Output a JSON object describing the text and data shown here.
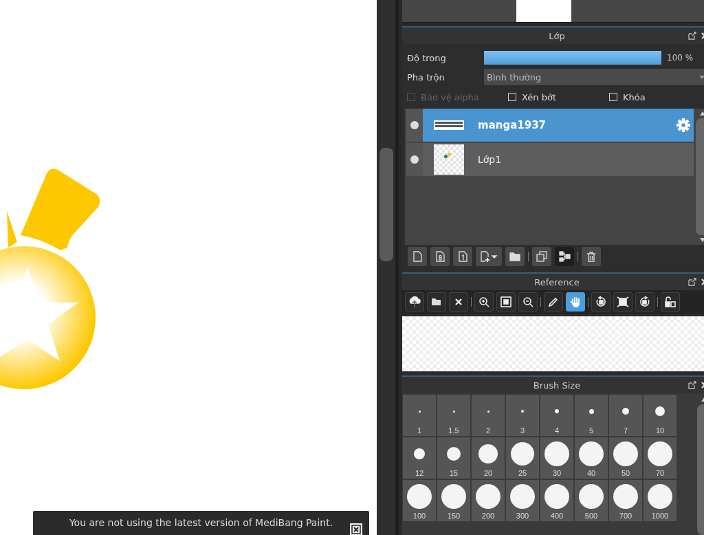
{
  "notification": {
    "message": "You are not using the latest version of MediBang Paint."
  },
  "layer_panel": {
    "title": "Lớp",
    "opacity": {
      "label": "Độ trong",
      "level": 1.0,
      "reading": "100 %"
    },
    "blend": {
      "label": "Pha trộn",
      "value": "Bình thường"
    },
    "options": [
      {
        "label": "Bảo vệ alpha",
        "checked": false,
        "disabled": true
      },
      {
        "label": "Xén bớt",
        "checked": false,
        "disabled": false
      },
      {
        "label": "Khóa",
        "checked": false,
        "disabled": false
      }
    ],
    "layers": [
      {
        "name": "manga1937",
        "selected": true,
        "visible": true,
        "kind": "image"
      },
      {
        "name": "Lớp1",
        "selected": false,
        "visible": true,
        "kind": "transparent"
      }
    ],
    "tools": [
      {
        "kind": "new"
      },
      {
        "kind": "new-8bit"
      },
      {
        "kind": "new-1bit"
      },
      {
        "kind": "add-menu"
      },
      {
        "kind": "folder"
      },
      {
        "kind": "separator"
      },
      {
        "kind": "duplicate"
      },
      {
        "kind": "merge"
      },
      {
        "kind": "separator"
      },
      {
        "kind": "delete"
      }
    ]
  },
  "reference_panel": {
    "title": "Reference",
    "tool_groups": [
      [
        {
          "kind": "upload",
          "selected": false
        },
        {
          "kind": "open",
          "selected": false
        },
        {
          "kind": "clear",
          "selected": false
        }
      ],
      [
        {
          "kind": "zoom-in",
          "selected": false
        },
        {
          "kind": "fit",
          "selected": false
        },
        {
          "kind": "zoom-out",
          "selected": false
        }
      ],
      [
        {
          "kind": "eyedropper",
          "selected": false
        },
        {
          "kind": "hand",
          "selected": true
        }
      ],
      [
        {
          "kind": "rotate-left",
          "selected": false
        },
        {
          "kind": "fill",
          "selected": false
        },
        {
          "kind": "rotate-right",
          "selected": false
        }
      ],
      [
        {
          "kind": "lock",
          "selected": false
        }
      ]
    ]
  },
  "brush_size_panel": {
    "title": "Brush Size",
    "sizes": [
      "1",
      "1.5",
      "2",
      "3",
      "4",
      "5",
      "7",
      "10",
      "12",
      "15",
      "20",
      "25",
      "30",
      "40",
      "50",
      "70",
      "100",
      "150",
      "200",
      "300",
      "400",
      "500",
      "700",
      "1000"
    ]
  }
}
